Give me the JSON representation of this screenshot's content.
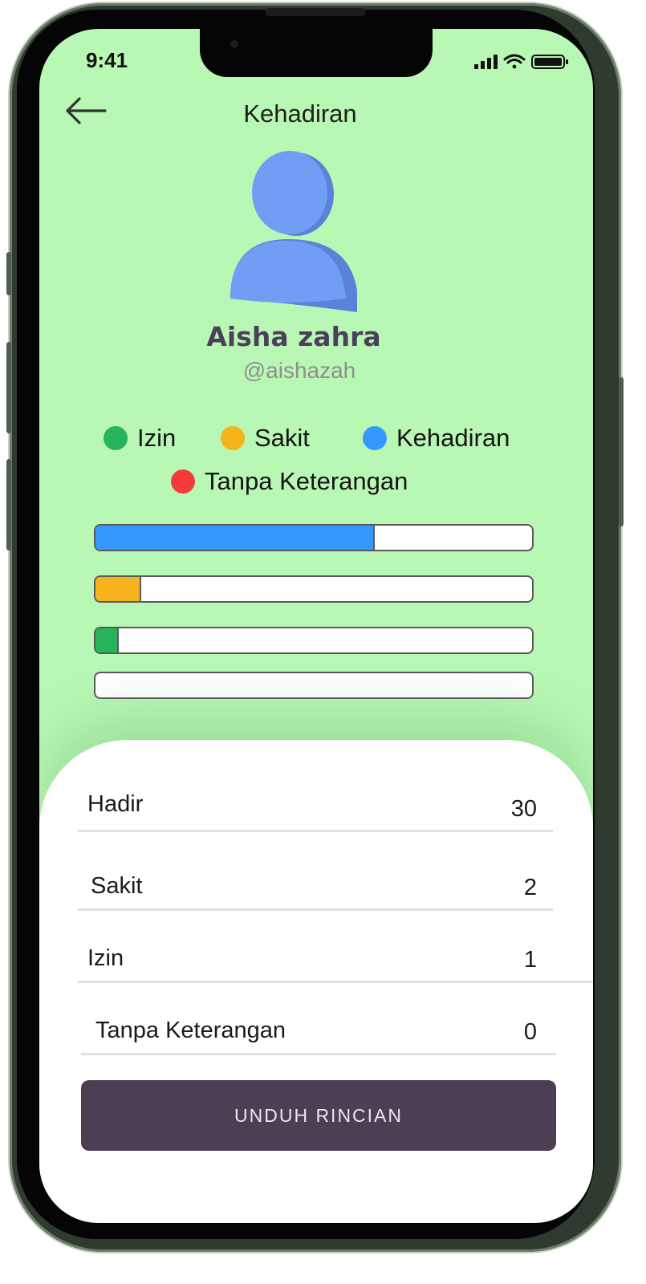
{
  "status_bar": {
    "time": "9:41"
  },
  "header": {
    "title": "Kehadiran"
  },
  "profile": {
    "name": "Aisha zahra",
    "handle": "@aishazah"
  },
  "legend": [
    {
      "label": "Izin",
      "color": "#27b35a"
    },
    {
      "label": "Sakit",
      "color": "#f6b31c"
    },
    {
      "label": "Kehadiran",
      "color": "#3399ff"
    },
    {
      "label": "Tanpa Keterangan",
      "color": "#f53a3a"
    }
  ],
  "progress_bars": [
    {
      "category": "Kehadiran",
      "fraction": 0.64,
      "color": "#3399ff"
    },
    {
      "category": "Sakit",
      "fraction": 0.105,
      "color": "#f6b31c"
    },
    {
      "category": "Izin",
      "fraction": 0.053,
      "color": "#27b35a"
    },
    {
      "category": "Tanpa Keterangan",
      "fraction": 0.0,
      "color": "#f53a3a"
    }
  ],
  "summary": [
    {
      "label": "Hadir",
      "value": "30"
    },
    {
      "label": "Sakit",
      "value": "2"
    },
    {
      "label": "Izin",
      "value": "1"
    },
    {
      "label": "Tanpa Keterangan",
      "value": "0"
    }
  ],
  "actions": {
    "download_label": "UNDUH RINCIAN"
  },
  "colors": {
    "screen_bg": "#b9f7b4",
    "avatar": "#6f9ef4",
    "button": "#4c3f53"
  }
}
